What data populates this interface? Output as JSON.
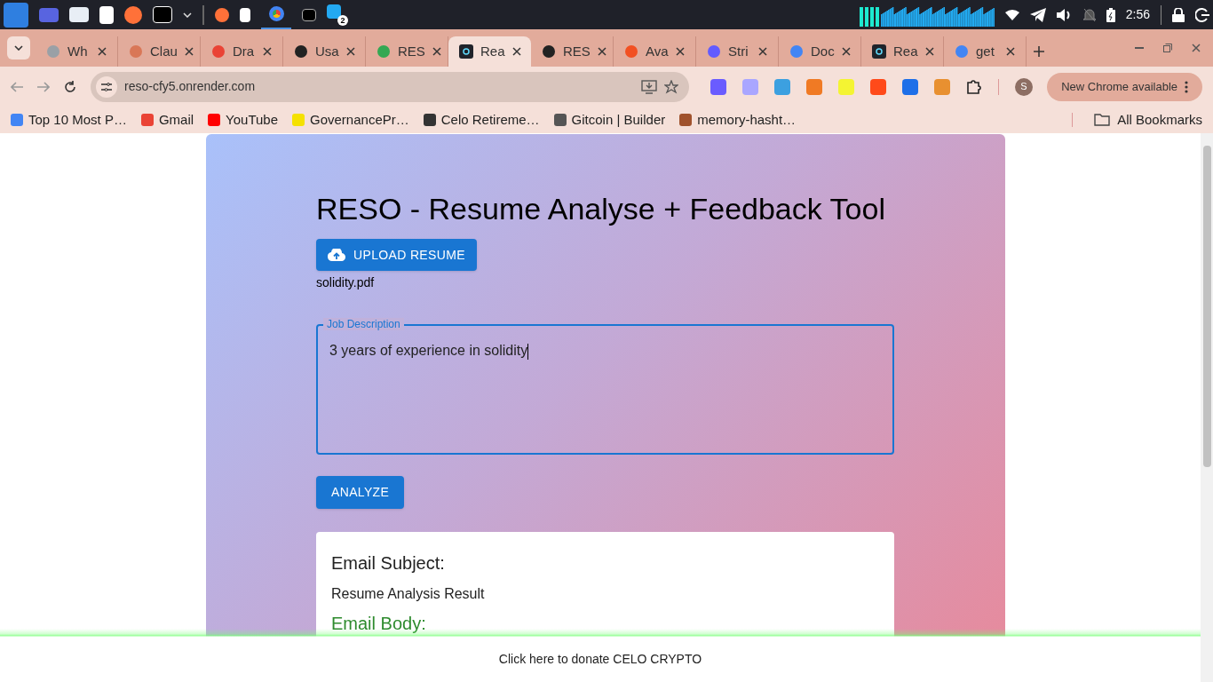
{
  "taskbar": {
    "badge": "2",
    "clock": "2:56"
  },
  "tabs": [
    {
      "title": "Wh",
      "selected": false
    },
    {
      "title": "Clau",
      "selected": false
    },
    {
      "title": "Dra",
      "selected": false
    },
    {
      "title": "Usa",
      "selected": false
    },
    {
      "title": "RES",
      "selected": false
    },
    {
      "title": "Rea",
      "selected": true
    },
    {
      "title": "RES",
      "selected": false
    },
    {
      "title": "Ava",
      "selected": false
    },
    {
      "title": "Stri",
      "selected": false
    },
    {
      "title": "Doc",
      "selected": false
    },
    {
      "title": "Rea",
      "selected": false
    },
    {
      "title": "get",
      "selected": false
    }
  ],
  "toolbar": {
    "address": "reso-cfy5.onrender.com",
    "profile": "S",
    "update": "New Chrome available"
  },
  "bookmarks": [
    "Top 10 Most P…",
    "Gmail",
    "YouTube",
    "GovernancePr…",
    "Celo Retireme…",
    "Gitcoin | Builder",
    "memory-hasht…"
  ],
  "all_bookmarks": "All Bookmarks",
  "page": {
    "title": "RESO - Resume Analyse + Feedback Tool",
    "upload": "UPLOAD RESUME",
    "file_name": "solidity.pdf",
    "job_label": "Job Description",
    "job_value": "3 years of experience in solidity",
    "analyze": "ANALYZE",
    "subject_heading": "Email Subject:",
    "subject": "Resume Analysis Result",
    "body_heading": "Email Body:"
  },
  "donate": "Click here to donate CELO CRYPTO"
}
